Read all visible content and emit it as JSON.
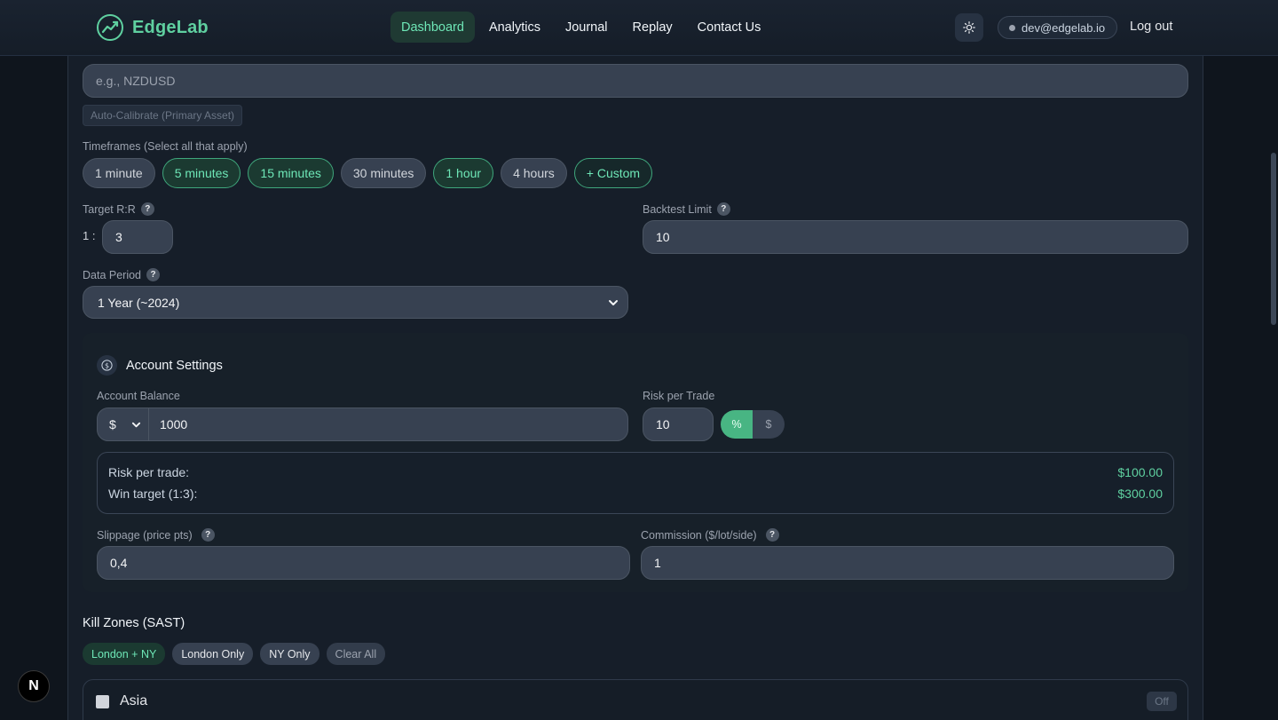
{
  "nav": {
    "brand": "EdgeLab",
    "links": [
      "Dashboard",
      "Analytics",
      "Journal",
      "Replay",
      "Contact Us"
    ],
    "active": "Dashboard",
    "theme_icon": "sun-icon",
    "user_email": "dev@edgelab.io",
    "logout": "Log out"
  },
  "asset": {
    "placeholder": "e.g., NZDUSD",
    "auto_calibrate": "Auto-Calibrate (Primary Asset)"
  },
  "timeframes": {
    "label": "Timeframes (Select all that apply)",
    "options": [
      {
        "label": "1 minute",
        "selected": false
      },
      {
        "label": "5 minutes",
        "selected": true
      },
      {
        "label": "15 minutes",
        "selected": true
      },
      {
        "label": "30 minutes",
        "selected": false
      },
      {
        "label": "1 hour",
        "selected": true
      },
      {
        "label": "4 hours",
        "selected": false
      }
    ],
    "custom": "+ Custom"
  },
  "target_rr": {
    "label": "Target R:R",
    "prefix": "1 :",
    "value": "3"
  },
  "backtest_limit": {
    "label": "Backtest Limit",
    "value": "10"
  },
  "data_period": {
    "label": "Data Period",
    "value": "1 Year (~2024)"
  },
  "account": {
    "title": "Account Settings",
    "balance_label": "Account Balance",
    "currency": "$",
    "balance": "1000",
    "risk_label": "Risk per Trade",
    "risk_value": "10",
    "risk_mode_percent": "%",
    "risk_mode_dollar": "$",
    "summary": {
      "risk_label": "Risk per trade:",
      "risk_value": "$100.00",
      "win_label": "Win target (1:3):",
      "win_value": "$300.00"
    },
    "slippage_label": "Slippage (price pts)",
    "slippage": "0,4",
    "commission_label": "Commission ($/lot/side)",
    "commission": "1"
  },
  "kill_zones": {
    "title": "Kill Zones (SAST)",
    "presets": [
      "London + NY",
      "London Only",
      "NY Only",
      "Clear All"
    ],
    "active_preset": "London + NY",
    "zones": [
      {
        "name": "Asia",
        "status": "Off"
      }
    ]
  },
  "colors": {
    "accent": "#5fd0a0",
    "background": "#0f151d",
    "panel": "#161e29"
  }
}
